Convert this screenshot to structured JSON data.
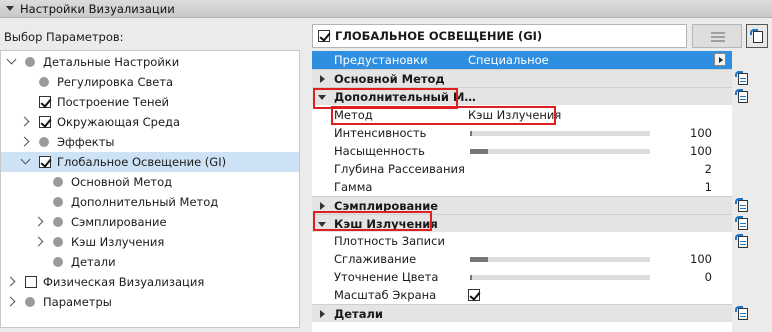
{
  "window": {
    "title": "Настройки Визуализации"
  },
  "left": {
    "header": "Выбор Параметров:",
    "tree": [
      {
        "label": "Детальные Настройки",
        "type": "dot",
        "chevron": "down",
        "selected": false
      },
      {
        "label": "Регулировка Света",
        "type": "dot",
        "chevron": "none",
        "selected": false
      },
      {
        "label": "Построение Теней",
        "type": "checkbox",
        "checked": true,
        "chevron": "none",
        "selected": false
      },
      {
        "label": "Окружающая Среда",
        "type": "checkbox",
        "checked": true,
        "chevron": "right",
        "selected": false
      },
      {
        "label": "Эффекты",
        "type": "dot",
        "chevron": "right",
        "selected": false
      },
      {
        "label": "Глобальное Освещение (GI)",
        "type": "checkbox",
        "checked": true,
        "chevron": "down",
        "selected": true
      },
      {
        "label": "Основной Метод",
        "type": "dot",
        "chevron": "none",
        "selected": false
      },
      {
        "label": "Дополнительный Метод",
        "type": "dot",
        "chevron": "none",
        "selected": false
      },
      {
        "label": "Сэмплирование",
        "type": "dot",
        "chevron": "right",
        "selected": false
      },
      {
        "label": "Кэш Излучения",
        "type": "dot",
        "chevron": "right",
        "selected": false
      },
      {
        "label": "Детали",
        "type": "dot",
        "chevron": "none",
        "selected": false
      },
      {
        "label": "Физическая Визуализация",
        "type": "checkbox",
        "checked": false,
        "chevron": "right",
        "selected": false
      },
      {
        "label": "Параметры",
        "type": "dot",
        "chevron": "right",
        "selected": false
      }
    ]
  },
  "right": {
    "header": {
      "label": "ГЛОБАЛЬНОЕ ОСВЕЩЕНИЕ (GI)",
      "checked": true
    },
    "rows": [
      {
        "kind": "blue",
        "label": "Предустановки",
        "value": "Специальное"
      },
      {
        "kind": "sec",
        "label": "Основной Метод",
        "expanded": false,
        "icon": true
      },
      {
        "kind": "sec",
        "label": "Дополнительный М…",
        "expanded": true,
        "icon": true
      },
      {
        "kind": "text",
        "label": "Метод",
        "value": "Кэш Излучения"
      },
      {
        "kind": "slider",
        "label": "Интенсивность",
        "value": "100",
        "level": 0
      },
      {
        "kind": "slider",
        "label": "Насыщенность",
        "value": "100",
        "level": 0.1
      },
      {
        "kind": "num",
        "label": "Глубина Рассеивания",
        "value": "2"
      },
      {
        "kind": "num",
        "label": "Гамма",
        "value": "1"
      },
      {
        "kind": "sec",
        "label": "Сэмплирование",
        "expanded": false,
        "icon": true
      },
      {
        "kind": "sec",
        "label": "Кэш Излучения",
        "expanded": true,
        "icon": true
      },
      {
        "kind": "blank",
        "label": "Плотность Записи",
        "icon": true
      },
      {
        "kind": "slider",
        "label": "Сглаживание",
        "value": "100",
        "level": 0.1
      },
      {
        "kind": "slider",
        "label": "Уточнение Цвета",
        "value": "0",
        "level": 0
      },
      {
        "kind": "check",
        "label": "Масштаб Экрана",
        "checked": true
      },
      {
        "kind": "sec",
        "label": "Детали",
        "expanded": false,
        "icon": true
      }
    ]
  },
  "colors": {
    "accent": "#2e8ee0",
    "highlight": "#e02020",
    "selection": "#cde3f5"
  }
}
